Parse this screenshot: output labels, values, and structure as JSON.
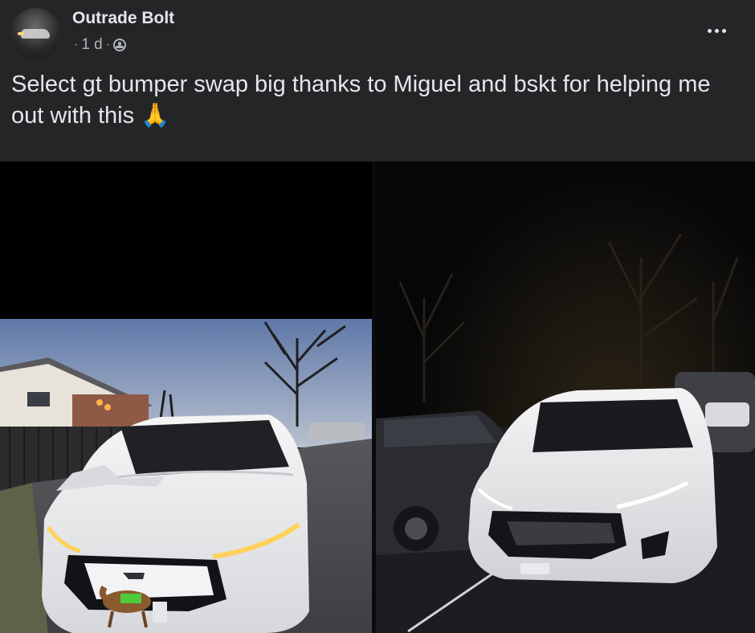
{
  "post": {
    "author": "Outrade Bolt",
    "meta_prefix": "·",
    "time": "1 d",
    "separator": "·",
    "caption": "Select gt bumper swap big thanks to Miguel and bskt for helping me out with this 🙏",
    "privacy_icon": "globe-icon",
    "more_icon": "ellipsis-icon"
  },
  "photos": [
    {
      "subject": "white-suv-daytime",
      "dominant_colors": [
        "#8fa3c4",
        "#f2f2f2",
        "#3a3a3a"
      ]
    },
    {
      "subject": "white-suv-night",
      "dominant_colors": [
        "#050608",
        "#ececec",
        "#2b2b2b"
      ]
    }
  ]
}
